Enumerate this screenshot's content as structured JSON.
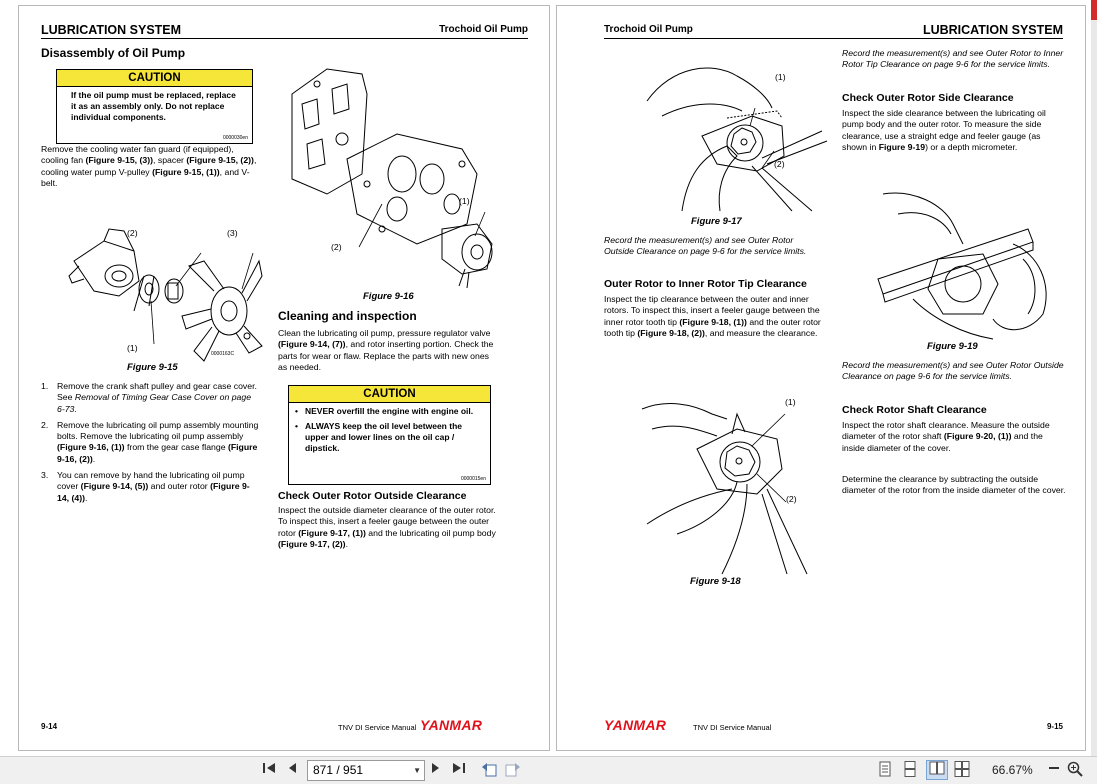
{
  "left_page": {
    "header_section": "LUBRICATION SYSTEM",
    "header_topic": "Trochoid Oil Pump",
    "title": "Disassembly of Oil Pump",
    "caution1": {
      "title": "CAUTION",
      "text": "If the oil pump must be replaced, replace it as an assembly only. Do not replace individual components.",
      "code": "0000030en"
    },
    "intro_parts": [
      {
        "t": "Remove the cooling water fan guard (if equipped), cooling fan ",
        "b": false
      },
      {
        "t": "(Figure 9-15, (3))",
        "b": true
      },
      {
        "t": ", spacer ",
        "b": false
      },
      {
        "t": "(Figure 9-15, (2))",
        "b": true
      },
      {
        "t": ", cooling water pump V-pulley ",
        "b": false
      },
      {
        "t": "(Figure 9-15, (1))",
        "b": true
      },
      {
        "t": ", and V-belt.",
        "b": false
      }
    ],
    "fig15": {
      "caption": "Figure 9-15",
      "c1": "(1)",
      "c2": "(2)",
      "c3": "(3)",
      "code": "0000163C"
    },
    "steps": [
      {
        "n": "1.",
        "parts": [
          {
            "t": "Remove the crank shaft pulley and gear case cover. See ",
            "b": false,
            "i": false
          },
          {
            "t": "Removal of Timing Gear Case Cover on page 6-73",
            "b": false,
            "i": true
          },
          {
            "t": ".",
            "b": false,
            "i": false
          }
        ]
      },
      {
        "n": "2.",
        "parts": [
          {
            "t": "Remove the lubricating oil pump assembly mounting bolts. Remove the lubricating oil pump assembly ",
            "b": false,
            "i": false
          },
          {
            "t": "(Figure 9-16, (1))",
            "b": true,
            "i": false
          },
          {
            "t": " from the gear case flange ",
            "b": false,
            "i": false
          },
          {
            "t": "(Figure 9-16, (2))",
            "b": true,
            "i": false
          },
          {
            "t": ".",
            "b": false,
            "i": false
          }
        ]
      },
      {
        "n": "3.",
        "parts": [
          {
            "t": "You can remove by hand the lubricating oil pump cover ",
            "b": false,
            "i": false
          },
          {
            "t": "(Figure 9-14, (5))",
            "b": true,
            "i": false
          },
          {
            "t": " and outer rotor ",
            "b": false,
            "i": false
          },
          {
            "t": "(Figure 9-14, (4))",
            "b": true,
            "i": false
          },
          {
            "t": ".",
            "b": false,
            "i": false
          }
        ]
      }
    ],
    "fig16": {
      "caption": "Figure 9-16",
      "c1": "(1)",
      "c2": "(2)"
    },
    "cleaning_title": "Cleaning and inspection",
    "cleaning_parts": [
      {
        "t": "Clean the lubricating oil pump, pressure regulator valve ",
        "b": false
      },
      {
        "t": "(Figure 9-14, (7))",
        "b": true
      },
      {
        "t": ", and rotor inserting portion. Check the parts for wear or flaw. Replace the parts with new ones as needed.",
        "b": false
      }
    ],
    "caution2": {
      "title": "CAUTION",
      "b1": "NEVER overfill the engine with engine oil.",
      "b2": "ALWAYS keep the oil level between the upper and lower lines on the oil cap / dipstick.",
      "code": "0000015en"
    },
    "outer_title": "Check Outer Rotor Outside Clearance",
    "outer_parts": [
      {
        "t": "Inspect the outside diameter clearance of the outer rotor. To inspect this, insert a feeler gauge between the outer rotor ",
        "b": false
      },
      {
        "t": "(Figure 9-17, (1))",
        "b": true
      },
      {
        "t": " and the lubricating oil pump body ",
        "b": false
      },
      {
        "t": "(Figure 9-17, (2))",
        "b": true
      },
      {
        "t": ".",
        "b": false
      }
    ],
    "footer_page": "9-14",
    "footer_manual": "TNV DI Service Manual",
    "logo": "YANMAR"
  },
  "right_page": {
    "header_topic": "Trochoid Oil Pump",
    "header_section": "LUBRICATION SYSTEM",
    "fig17": {
      "caption": "Figure 9-17",
      "c1": "(1)",
      "c2": "(2)"
    },
    "record1": "Record the measurement(s) and see Outer Rotor Outside Clearance on page 9-6 for the service limits.",
    "tip_title": "Outer Rotor to Inner Rotor Tip Clearance",
    "tip_parts": [
      {
        "t": "Inspect the tip clearance between the outer and inner rotors. To inspect this, insert a feeler gauge between the inner rotor tooth tip ",
        "b": false
      },
      {
        "t": "(Figure 9-18, (1))",
        "b": true
      },
      {
        "t": " and the outer rotor tooth tip ",
        "b": false
      },
      {
        "t": "(Figure 9-18, (2))",
        "b": true
      },
      {
        "t": ", and measure the clearance.",
        "b": false
      }
    ],
    "fig18": {
      "caption": "Figure 9-18",
      "c1": "(1)",
      "c2": "(2)"
    },
    "record_top": "Record the measurement(s) and see Outer Rotor to Inner Rotor Tip Clearance on page 9-6 for the service limits.",
    "side_title": "Check Outer Rotor Side Clearance",
    "side_parts": [
      {
        "t": "Inspect the side clearance between the lubricating oil pump body and the outer rotor.  To measure the side clearance, use a straight edge and feeler gauge (as shown in ",
        "b": false
      },
      {
        "t": "Figure 9-19",
        "b": true
      },
      {
        "t": ") or a depth micrometer.",
        "b": false
      }
    ],
    "fig19": {
      "caption": "Figure 9-19"
    },
    "record2": "Record the measurement(s) and see Outer Rotor Outside Clearance on page 9-6 for the service limits.",
    "shaft_title": "Check Rotor Shaft Clearance",
    "shaft_parts": [
      {
        "t": "Inspect the rotor shaft clearance. Measure the outside diameter of the rotor shaft ",
        "b": false
      },
      {
        "t": "(Figure 9-20, (1))",
        "b": true
      },
      {
        "t": " and the inside diameter of the cover.",
        "b": false
      }
    ],
    "determine": "Determine the clearance by subtracting the outside diameter of the rotor from the inside diameter of the cover.",
    "logo": "YANMAR",
    "footer_manual": "TNV DI Service Manual",
    "footer_page": "9-15"
  },
  "toolbar": {
    "page_value": "871 / 951",
    "zoom": "66.67%",
    "icons": [
      "first-page-icon",
      "prev-page-icon",
      "next-page-icon",
      "last-page-icon",
      "go-back-icon",
      "go-forward-icon",
      "single-page-view-icon",
      "continuous-view-icon",
      "two-page-view-icon",
      "two-page-continuous-icon",
      "zoom-out-icon",
      "zoom-in-icon"
    ]
  }
}
